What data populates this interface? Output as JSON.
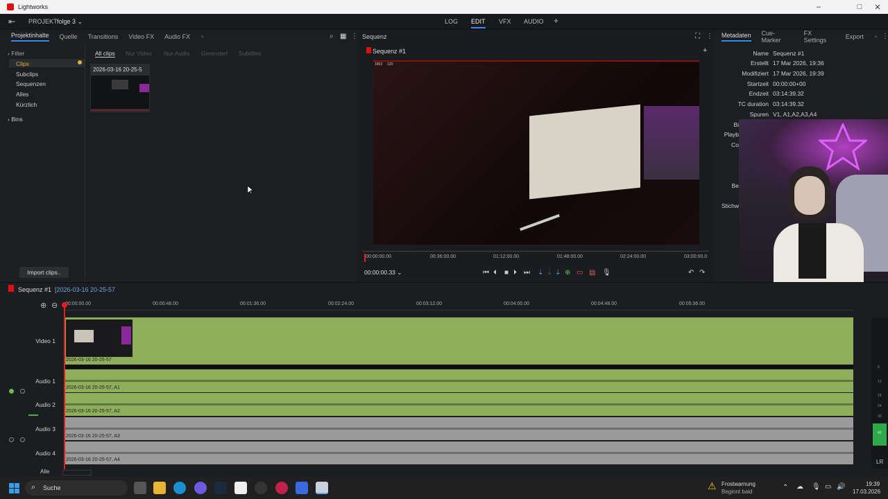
{
  "window": {
    "title": "Lightworks"
  },
  "topnav": {
    "project_label": "PROJEKT",
    "project_name": "folge 3",
    "tabs": [
      "LOG",
      "EDIT",
      "VFX",
      "AUDIO"
    ],
    "active_tab": "EDIT",
    "add": "+"
  },
  "browser": {
    "tabs": [
      "Projektinhalte",
      "Quelle",
      "Transitions",
      "Video FX",
      "Audio FX"
    ],
    "add": "+",
    "tree": {
      "filter": "Filter",
      "items": [
        "Clips",
        "Subclips",
        "Sequenzen",
        "Alles",
        "Kürzlich"
      ],
      "bins": "Bins"
    },
    "subtabs": [
      "All clips",
      "Nur Video",
      "Nur Audio",
      "Gerendert",
      "Subtitles"
    ],
    "clip_name": "2026-03-16 20-25-5",
    "import_button": "Import clips.."
  },
  "viewer": {
    "header": "Sequenz",
    "title": "Sequenz #1",
    "add": "+",
    "overlay_text": [
      "1802",
      "120"
    ],
    "ruler": [
      "00:00:00.00",
      "00:36:00.00",
      "01:12:00.00",
      "01:48:00.00",
      "02:24:00.00",
      "03:00:00.0"
    ],
    "timecode": "00:00:00.33",
    "timecode_caret": "⌄"
  },
  "metadata": {
    "tabs": [
      "Metadaten",
      "Cue-Marker",
      "FX Settings",
      "Export"
    ],
    "add": "+",
    "rows": [
      {
        "label": "Name",
        "value": "Sequenz #1"
      },
      {
        "label": "Erstellt",
        "value": "17 Mar 2026, 19:36"
      },
      {
        "label": "Modifiziert",
        "value": "17 Mar 2026, 19:39"
      },
      {
        "label": "Startzeit",
        "value": "00:00:00+00"
      },
      {
        "label": "Endzeit",
        "value": "03:14:39.32"
      },
      {
        "label": "TC duration",
        "value": "03:14:39.32"
      },
      {
        "label": "Spuren",
        "value": "V1, A1,A2,A3,A4"
      }
    ],
    "partial_labels": [
      "Bi",
      "Playb",
      "Co",
      "Be",
      "Stichw"
    ]
  },
  "timeline": {
    "title": "Sequenz #1",
    "subtitle": "[2026-03-16 20-25-57",
    "ruler": [
      "00:00:00.00",
      "00:00:48.00",
      "00:01:36.00",
      "00:02:24.00",
      "00:03:12.00",
      "00:04:00.00",
      "00:04:48.00",
      "00:05:36.00"
    ],
    "tracks": [
      {
        "name": "Video 1",
        "clip": "2026-03-16 20-25-57"
      },
      {
        "name": "Audio 1",
        "clip": "2026-03-16 20-25-57, A1"
      },
      {
        "name": "Audio 2",
        "clip": "2026-03-16 20-25-57, A2"
      },
      {
        "name": "Audio 3",
        "clip": "2026-03-16 20-25-57, A3"
      },
      {
        "name": "Audio 4",
        "clip": "2026-03-16 20-25-57, A4"
      }
    ],
    "all_label": "Alle",
    "meter_labels": [
      "6",
      "12",
      "18",
      "24",
      "30",
      "42"
    ],
    "lr": "LR"
  },
  "taskbar": {
    "search": "Suche",
    "weather_title": "Frostwarnung",
    "weather_sub": "Beginnt bald",
    "time": "19:39",
    "date": "17.03.2026"
  },
  "colors": {
    "accent": "#2d8df0",
    "clip_green": "#8fae5c",
    "playhead": "#e02020"
  }
}
